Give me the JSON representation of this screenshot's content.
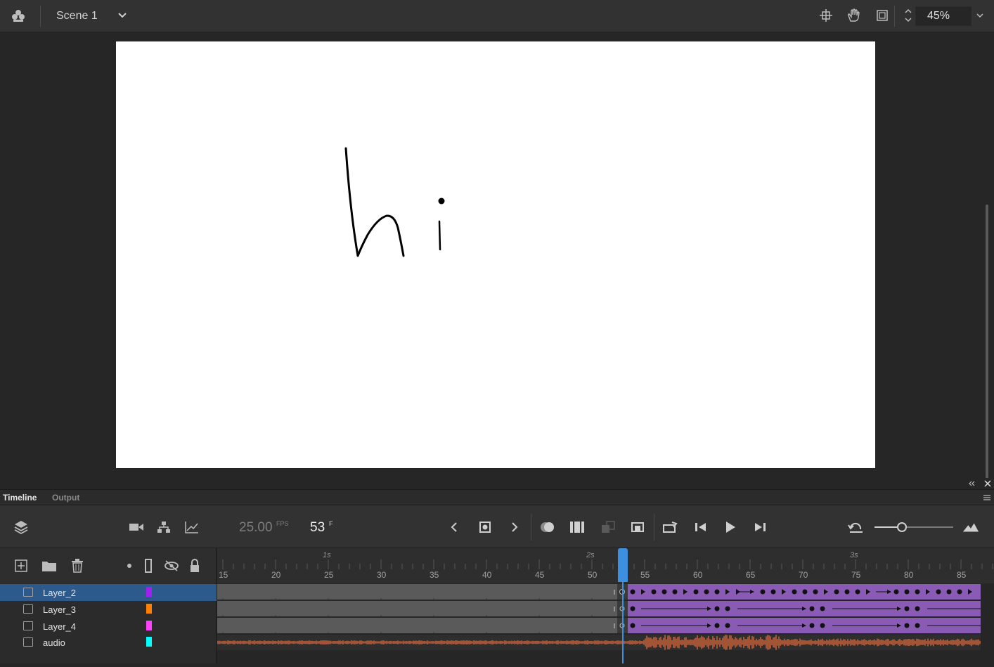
{
  "topbar": {
    "scene_label": "Scene 1",
    "zoom_value": "45%",
    "icons": [
      "scene-icon",
      "chevron-down-icon",
      "center-stage-icon",
      "hand-icon",
      "clip-canvas-icon",
      "zoom-stepper-icon",
      "zoom-dropdown-icon"
    ]
  },
  "stage": {
    "background_color": "#ffffff",
    "drawing_text": "hi"
  },
  "panel": {
    "tabs": [
      {
        "label": "Timeline",
        "active": true
      },
      {
        "label": "Output",
        "active": false
      }
    ]
  },
  "timeline": {
    "fps_value": "25.00",
    "fps_unit": "FPS",
    "frame_value": "53",
    "frame_unit": "F",
    "ruler": {
      "seconds": [
        "1s",
        "2s",
        "3s"
      ],
      "frames": [
        "15",
        "20",
        "25",
        "30",
        "35",
        "40",
        "45",
        "50",
        "55",
        "60",
        "65",
        "70",
        "75",
        "80",
        "85"
      ]
    },
    "layers": [
      {
        "name": "Layer_2",
        "color": "#a020f0",
        "selected": true
      },
      {
        "name": "Layer_3",
        "color": "#ff7f00",
        "selected": false
      },
      {
        "name": "Layer_4",
        "color": "#ff40ff",
        "selected": false
      },
      {
        "name": "audio",
        "color": "#00ffff",
        "selected": false
      }
    ],
    "colors": {
      "tween": "#8a5bb5",
      "empty_frames": "#5a5a5a",
      "playhead": "#3d8fe0",
      "waveform": "#e06a3a"
    }
  }
}
